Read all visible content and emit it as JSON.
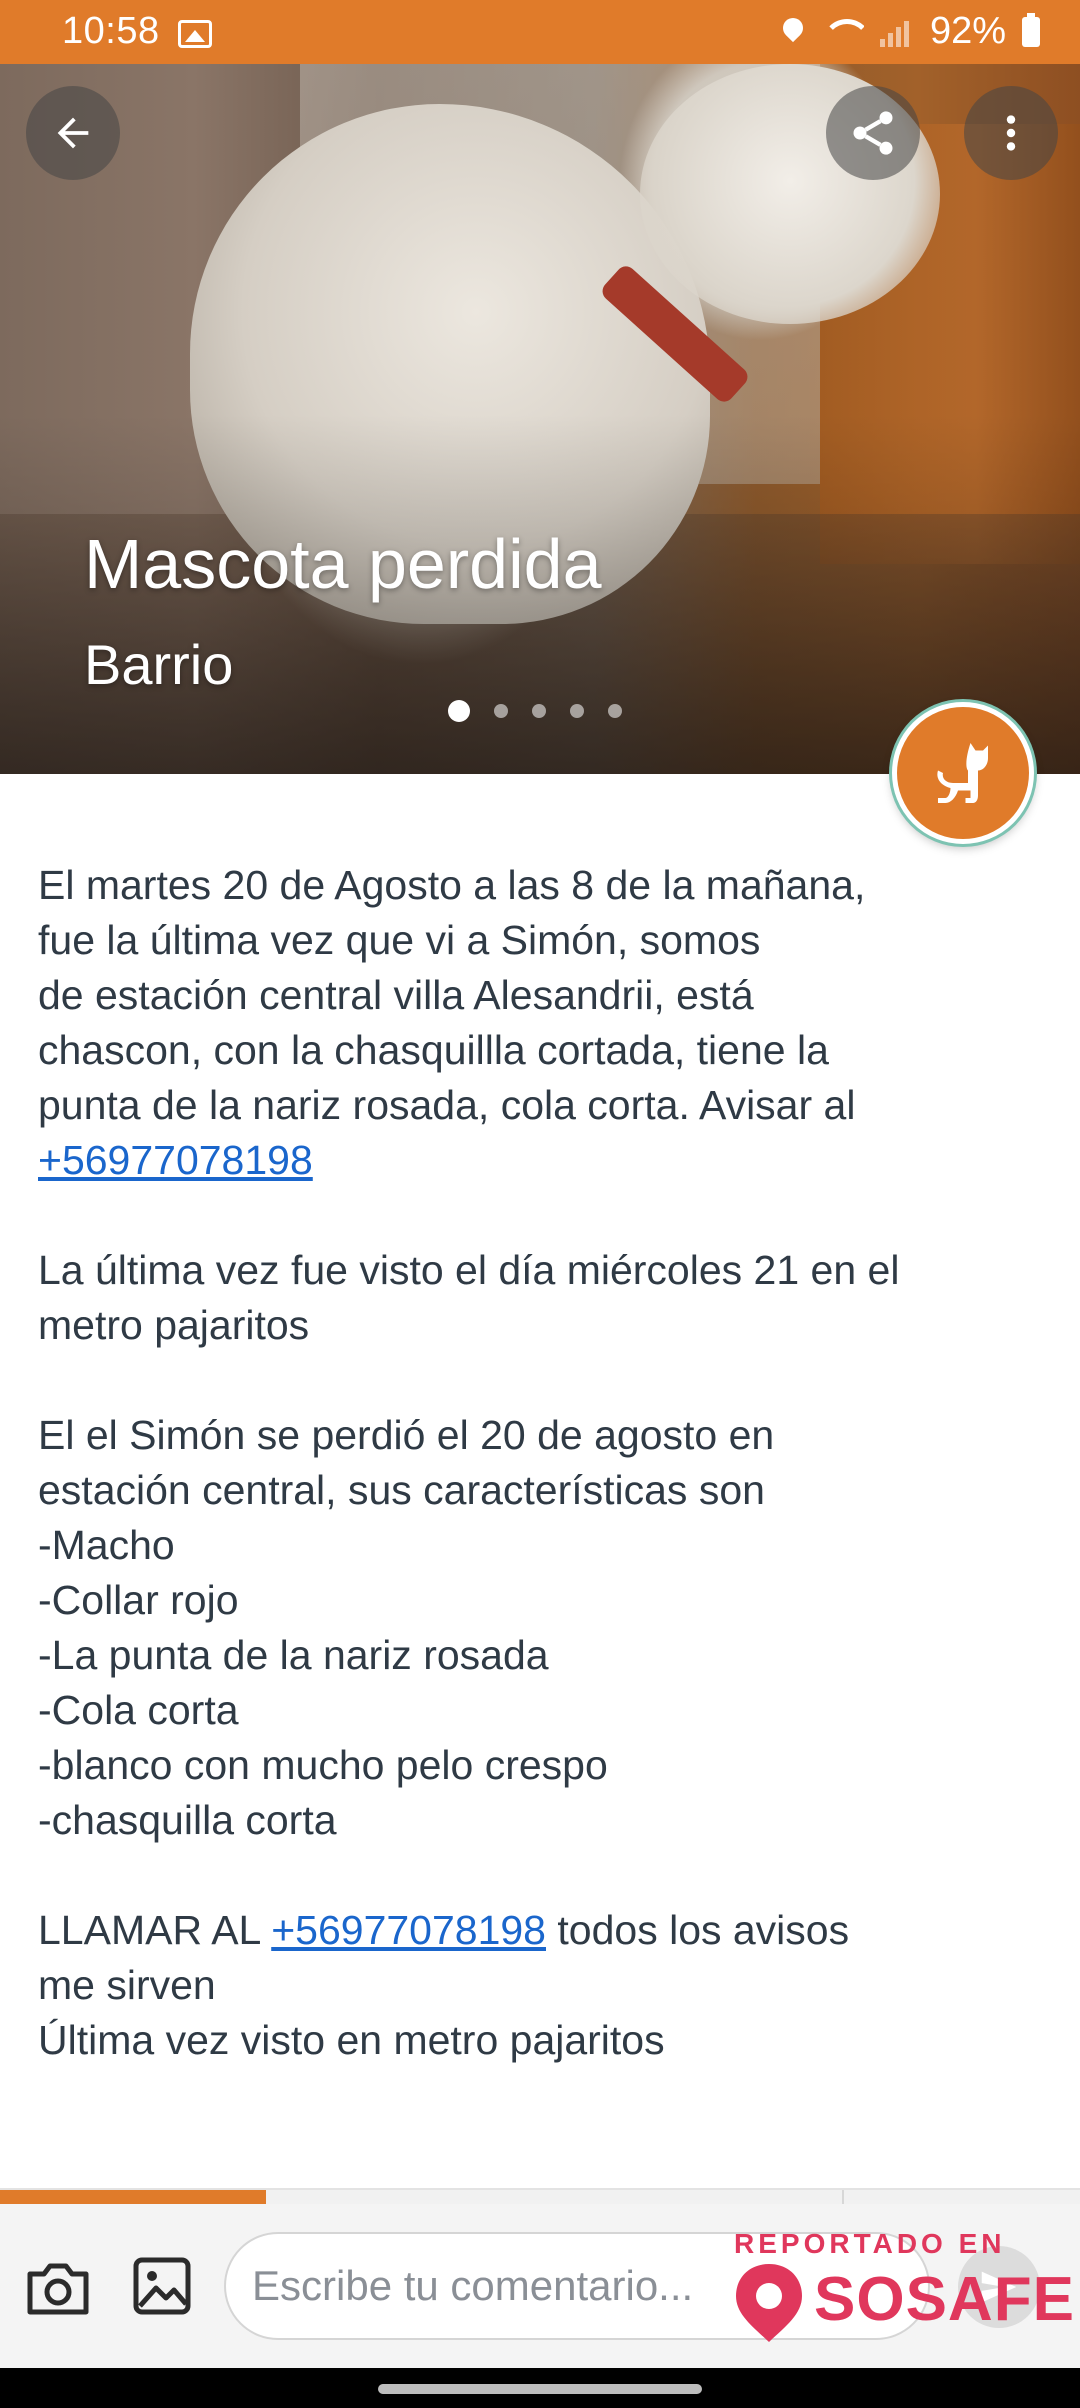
{
  "status_bar": {
    "time": "10:58",
    "battery": "92%"
  },
  "hero": {
    "title": "Mascota perdida",
    "subtitle": "Barrio",
    "carousel_page_count": 5,
    "carousel_active_index": 0,
    "category_icon": "dog-icon"
  },
  "post": {
    "p1_text": "El martes 20 de Agosto a las 8 de la mañana,\nfue la última vez que vi a Simón, somos\nde estación central villa Alesandrii, está\nchascon, con la chasquillla cortada, tiene la\npunta de la nariz rosada, cola corta. Avisar al",
    "p1_phone": "+56977078198",
    "p2_text": "La última vez fue visto el día miércoles 21 en el\nmetro pajaritos",
    "p3_text": "El el Simón se perdió el 20 de agosto en\nestación central, sus características son\n-Macho\n-Collar rojo\n-La punta de la nariz rosada\n-Cola corta\n-blanco con mucho pelo crespo\n-chasquilla corta",
    "p4_prefix": "LLAMAR AL ",
    "p4_phone": "+56977078198",
    "p4_suffix": " todos los avisos\nme sirven\nÚltima vez visto en metro pajaritos"
  },
  "comment_bar": {
    "placeholder": "Escribe tu comentario..."
  },
  "watermark": {
    "reported_label": "REPORTADO EN",
    "brand": "SOSAFE"
  },
  "colors": {
    "accent": "#e07b2a",
    "link": "#1a66cc",
    "brand": "#e0375c",
    "text": "#2f3a45"
  }
}
